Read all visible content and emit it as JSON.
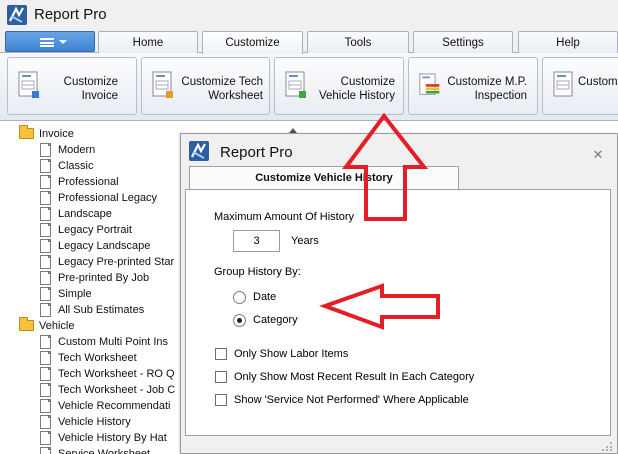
{
  "app": {
    "title": "Report Pro"
  },
  "tabs": [
    {
      "label": "Home"
    },
    {
      "label": "Customize"
    },
    {
      "label": "Tools"
    },
    {
      "label": "Settings"
    },
    {
      "label": "Help"
    }
  ],
  "ribbon": {
    "buttons": [
      {
        "line1": "Customize",
        "line2": "Invoice"
      },
      {
        "line1": "Customize Tech",
        "line2": "Worksheet"
      },
      {
        "line1": "Customize",
        "line2": "Vehicle History"
      },
      {
        "line1": "Customize M.P.",
        "line2": "Inspection"
      },
      {
        "line1": "Custom",
        "line2": ""
      }
    ]
  },
  "tree": {
    "groups": [
      {
        "label": "Invoice",
        "items": [
          "Modern",
          "Classic",
          "Professional",
          "Professional Legacy",
          "Landscape",
          "Legacy Portrait",
          "Legacy Landscape",
          "Legacy Pre-printed Star",
          "Pre-printed By Job",
          "Simple",
          "All Sub Estimates"
        ]
      },
      {
        "label": "Vehicle",
        "items": [
          "Custom Multi Point Ins",
          "Tech Worksheet",
          "Tech Worksheet - RO Q",
          "Tech Worksheet - Job C",
          "Vehicle Recommendati",
          "Vehicle History",
          "Vehicle History By Hat",
          "Service Worksheet"
        ]
      }
    ]
  },
  "dialog": {
    "title": "Report Pro",
    "tab_label": "Customize Vehicle History",
    "max_history_label": "Maximum Amount Of History",
    "max_history_value": "3",
    "years_label": "Years",
    "group_by_label": "Group History By:",
    "group_options": [
      {
        "label": "Date",
        "checked": false
      },
      {
        "label": "Category",
        "checked": true
      }
    ],
    "checkboxes": [
      {
        "label": "Only Show Labor Items",
        "checked": false
      },
      {
        "label": "Only Show Most Recent Result In Each Category",
        "checked": false
      },
      {
        "label": "Show 'Service Not Performed' Where Applicable",
        "checked": false
      }
    ]
  },
  "colors": {
    "accent_blue": "#4a8ad8",
    "folder_yellow": "#f5c23e",
    "annotation_red": "#e41e26"
  },
  "icons": [
    "app-logo-icon",
    "folder-icon",
    "page-icon",
    "report-doc-icon",
    "close-icon",
    "menu-icon"
  ]
}
